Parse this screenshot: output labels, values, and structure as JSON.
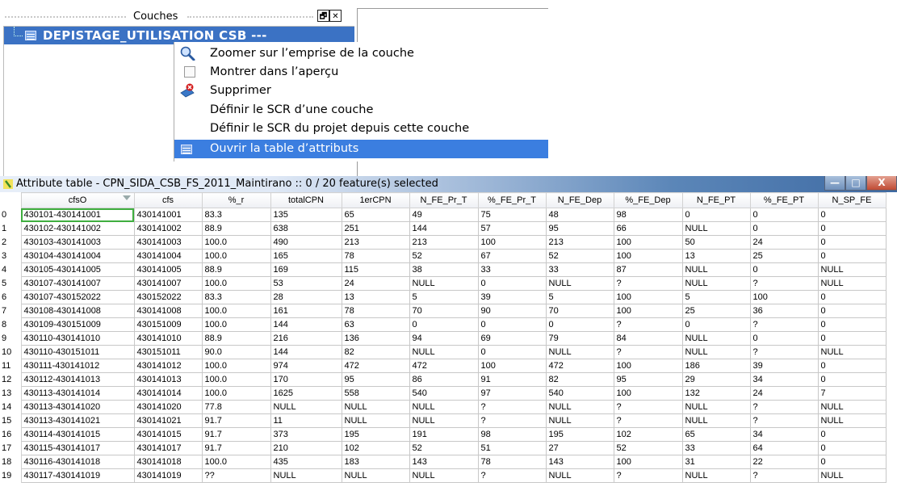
{
  "layers_panel": {
    "title": "Couches",
    "float_btn": "🗗",
    "close_btn": "✕",
    "layer_name": "DEPISTAGE_UTILISATION CSB ---"
  },
  "context_menu": {
    "items": [
      {
        "label": "Zoomer sur l’emprise de la couche",
        "icon": "zoom-icon"
      },
      {
        "label": "Montrer dans l’aperçu",
        "icon": "checkbox-icon"
      },
      {
        "label": "Supprimer",
        "icon": "remove-icon"
      },
      {
        "label": "Définir le SCR d’une couche",
        "icon": ""
      },
      {
        "label": "Définir le SCR du projet depuis cette couche",
        "icon": ""
      },
      {
        "label": "Ouvrir la table d’attributs",
        "icon": "table-icon",
        "selected": true
      }
    ]
  },
  "attribute_table": {
    "title": "Attribute table - CPN_SIDA_CSB_FS_2011_Maintirano :: 0 / 20 feature(s) selected",
    "win_min": "—",
    "win_max": "□",
    "win_close": "X",
    "columns": [
      "cfsO",
      "cfs",
      "%_r",
      "totalCPN",
      "1erCPN",
      "N_FE_Pr_T",
      "%_FE_Pr_T",
      "N_FE_Dep",
      "%_FE_Dep",
      "N_FE_PT",
      "%_FE_PT",
      "N_SP_FE"
    ],
    "rows": [
      [
        "0",
        "430101-430141001",
        "430141001",
        "83.3",
        "135",
        "65",
        "49",
        "75",
        "48",
        "98",
        "0",
        "0",
        "0"
      ],
      [
        "1",
        "430102-430141002",
        "430141002",
        "88.9",
        "638",
        "251",
        "144",
        "57",
        "95",
        "66",
        "NULL",
        "0",
        "0"
      ],
      [
        "2",
        "430103-430141003",
        "430141003",
        "100.0",
        "490",
        "213",
        "213",
        "100",
        "213",
        "100",
        "50",
        "24",
        "0"
      ],
      [
        "3",
        "430104-430141004",
        "430141004",
        "100.0",
        "165",
        "78",
        "52",
        "67",
        "52",
        "100",
        "13",
        "25",
        "0"
      ],
      [
        "4",
        "430105-430141005",
        "430141005",
        "88.9",
        "169",
        "115",
        "38",
        "33",
        "33",
        "87",
        "NULL",
        "0",
        "NULL"
      ],
      [
        "5",
        "430107-430141007",
        "430141007",
        "100.0",
        "53",
        "24",
        "NULL",
        "0",
        "NULL",
        "?",
        "NULL",
        "?",
        "NULL"
      ],
      [
        "6",
        "430107-430152022",
        "430152022",
        "83.3",
        "28",
        "13",
        "5",
        "39",
        "5",
        "100",
        "5",
        "100",
        "0"
      ],
      [
        "7",
        "430108-430141008",
        "430141008",
        "100.0",
        "161",
        "78",
        "70",
        "90",
        "70",
        "100",
        "25",
        "36",
        "0"
      ],
      [
        "8",
        "430109-430151009",
        "430151009",
        "100.0",
        "144",
        "63",
        "0",
        "0",
        "0",
        "?",
        "0",
        "?",
        "0"
      ],
      [
        "9",
        "430110-430141010",
        "430141010",
        "88.9",
        "216",
        "136",
        "94",
        "69",
        "79",
        "84",
        "NULL",
        "0",
        "0"
      ],
      [
        "10",
        "430110-430151011",
        "430151011",
        "90.0",
        "144",
        "82",
        "NULL",
        "0",
        "NULL",
        "?",
        "NULL",
        "?",
        "NULL"
      ],
      [
        "11",
        "430111-430141012",
        "430141012",
        "100.0",
        "974",
        "472",
        "472",
        "100",
        "472",
        "100",
        "186",
        "39",
        "0"
      ],
      [
        "12",
        "430112-430141013",
        "430141013",
        "100.0",
        "170",
        "95",
        "86",
        "91",
        "82",
        "95",
        "29",
        "34",
        "0"
      ],
      [
        "13",
        "430113-430141014",
        "430141014",
        "100.0",
        "1625",
        "558",
        "540",
        "97",
        "540",
        "100",
        "132",
        "24",
        "7"
      ],
      [
        "14",
        "430113-430141020",
        "430141020",
        "77.8",
        "NULL",
        "NULL",
        "NULL",
        "?",
        "NULL",
        "?",
        "NULL",
        "?",
        "NULL"
      ],
      [
        "15",
        "430113-430141021",
        "430141021",
        "91.7",
        "11",
        "NULL",
        "NULL",
        "?",
        "NULL",
        "?",
        "NULL",
        "?",
        "NULL"
      ],
      [
        "16",
        "430114-430141015",
        "430141015",
        "91.7",
        "373",
        "195",
        "191",
        "98",
        "195",
        "102",
        "65",
        "34",
        "0"
      ],
      [
        "17",
        "430115-430141017",
        "430141017",
        "91.7",
        "210",
        "102",
        "52",
        "51",
        "27",
        "52",
        "33",
        "64",
        "0"
      ],
      [
        "18",
        "430116-430141018",
        "430141018",
        "100.0",
        "435",
        "183",
        "143",
        "78",
        "143",
        "100",
        "31",
        "22",
        "0"
      ],
      [
        "19",
        "430117-430141019",
        "430141019",
        "??",
        "NULL",
        "NULL",
        "NULL",
        "?",
        "NULL",
        "?",
        "NULL",
        "?",
        "NULL"
      ]
    ]
  }
}
